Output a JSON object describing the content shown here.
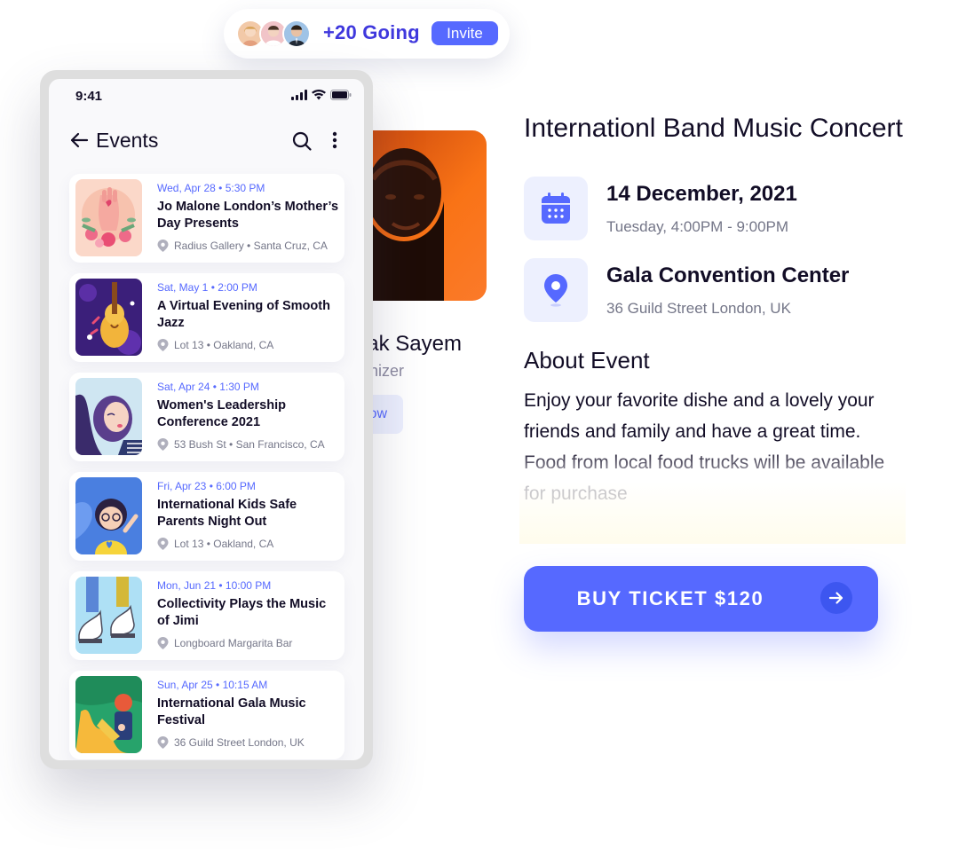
{
  "going_pill": {
    "avatars": [
      "avatar-1",
      "avatar-2",
      "avatar-3"
    ],
    "count_label": "+20 Going",
    "invite_label": "Invite"
  },
  "background_detail": {
    "organizer_name": "ak Sayem",
    "organizer_role": "nizer",
    "follow_label": "ow"
  },
  "phone": {
    "status_time": "9:41",
    "header_title": "Events",
    "events": [
      {
        "date": "Wed, Apr 28 • 5:30 PM",
        "title": "Jo Malone London’s Mother’s Day Presents",
        "location": "Radius Gallery • Santa Cruz, CA",
        "thumb": "hand-flowers"
      },
      {
        "date": "Sat, May 1 • 2:00 PM",
        "title": "A Virtual Evening of Smooth Jazz",
        "location": "Lot 13 • Oakland, CA",
        "thumb": "violin"
      },
      {
        "date": "Sat, Apr 24 • 1:30 PM",
        "title": "Women's Leadership Conference 2021",
        "location": "53 Bush St • San Francisco, CA",
        "thumb": "woman-portrait"
      },
      {
        "date": "Fri, Apr 23 • 6:00 PM",
        "title": "International Kids Safe Parents Night Out",
        "location": "Lot 13 • Oakland, CA",
        "thumb": "kid"
      },
      {
        "date": "Mon, Jun 21 • 10:00 PM",
        "title": "Collectivity Plays the Music of Jimi",
        "location": "Longboard Margarita Bar",
        "thumb": "sneakers"
      },
      {
        "date": "Sun, Apr 25 • 10:15 AM",
        "title": "International Gala Music Festival",
        "location": "36 Guild Street London, UK",
        "thumb": "saxophone"
      }
    ]
  },
  "detail": {
    "title": "Internationl Band Music Concert",
    "date_main": "14 December, 2021",
    "date_sub": "Tuesday, 4:00PM - 9:00PM",
    "venue_main": "Gala Convention Center",
    "venue_sub": "36 Guild Street London, UK",
    "about_heading": "About Event",
    "about_text": "Enjoy your favorite dishe and a lovely your friends and family and have a great time. Food from local food trucks will be available for purchase",
    "buy_label": "BUY TICKET $120"
  },
  "colors": {
    "accent": "#5669ff",
    "accent_dark": "#3f38dd",
    "icon_bg": "#edf0fe",
    "text": "#120d26",
    "muted": "#747688"
  },
  "icons": [
    "arrow-left-icon",
    "search-icon",
    "more-vertical-icon",
    "signal-icon",
    "wifi-icon",
    "battery-icon",
    "map-pin-icon",
    "calendar-icon",
    "location-icon",
    "arrow-right-icon"
  ]
}
